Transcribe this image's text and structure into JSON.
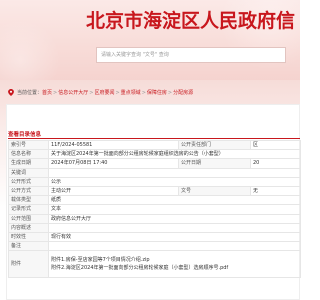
{
  "header": {
    "site_title": "北京市海淀区人民政府信",
    "search_placeholder": "请输入关键字查询 \"文号\" 查询"
  },
  "breadcrumb": {
    "prefix": "当前位置：",
    "items": [
      "首页",
      "信息公开大厅",
      "区府要闻",
      "重点领域",
      "保障住房",
      "分配房源"
    ],
    "separator": ">"
  },
  "panel": {
    "title": "查看目录信息"
  },
  "metadata": {
    "index_no_label": "索引号",
    "index_no_value": "11F/2024-05581",
    "publisher_label": "公开责任部门",
    "publisher_value": "区",
    "name_label": "信息名称",
    "name_value": "关于海淀区2024年第一批面向部分公租房轮候家庭组织选房的公告（小套型）",
    "generated_label": "生成日期",
    "generated_value": "2024年07月08日 17:40",
    "published_label": "公开日期",
    "published_value": "20",
    "keywords_label": "关键词",
    "keywords_value": "",
    "publish_form_label": "公开形式",
    "publish_form_value": "公示",
    "publish_type_label": "公开方式",
    "publish_type_value": "主动公开",
    "doc_no_label": "文号",
    "doc_no_value": "无",
    "carrier_label": "载体类型",
    "carrier_value": "纸质",
    "record_form_label": "记录形式",
    "record_form_value": "文本",
    "location_label": "公开范围",
    "location_value": "政府信息公开大厅",
    "summary_label": "内容概述",
    "summary_value": "",
    "validity_label": "时效性",
    "validity_value": "现行有效",
    "remarks_label": "备注",
    "remarks_value": "",
    "attachments_label": "附件",
    "attachments": [
      "附件1.房保-至店家园等7个项目情况介绍.zip",
      "附件2.海淀区2024年第一批面向部分公租房轮候家庭（小套型）选房顺序号.pdf"
    ]
  }
}
